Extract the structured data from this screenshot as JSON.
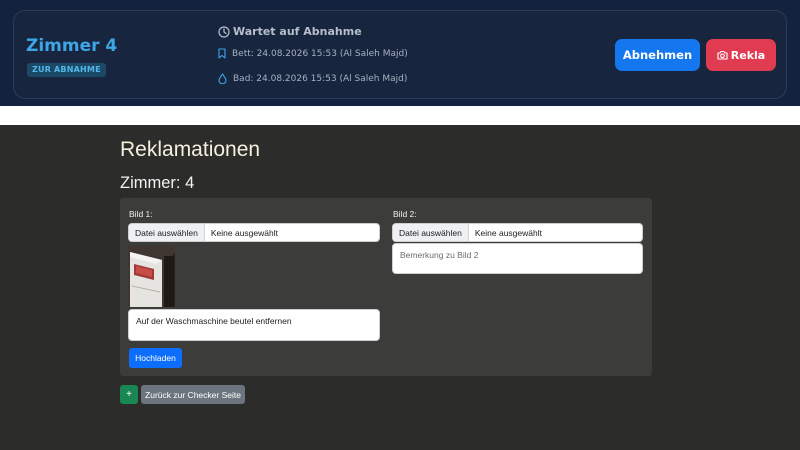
{
  "room_card": {
    "title": "Zimmer 4",
    "badge": "ZUR ABNAHME",
    "status": "Wartet auf Abnahme",
    "bed": "Bett: 24.08.2026 15:53 (Al Saleh Majd)",
    "bath": "Bad: 24.08.2026 15:53 (Al Saleh Majd)",
    "accept_label": "Abnehmen",
    "rekla_label": "Rekla",
    "icons": {
      "status": "clock-icon",
      "bed": "bookmark-icon",
      "bath": "droplet-icon",
      "rekla": "camera-icon"
    },
    "colors": {
      "accent": "#3ea6e6",
      "accept": "#1577f0",
      "rekla": "#e03b50"
    }
  },
  "reklamationen": {
    "heading": "Reklamationen",
    "room": "Zimmer: 4",
    "image1": {
      "label": "Bild 1:",
      "file_button": "Datei auswählen",
      "file_name": "Keine ausgewählt",
      "comment_value": "Auf der Waschmaschine beutel entfernen"
    },
    "image2": {
      "label": "Bild 2:",
      "file_button": "Datei auswählen",
      "file_name": "Keine ausgewählt",
      "comment_placeholder": "Bemerkung zu Bild 2"
    },
    "upload_label": "Hochladen",
    "add_label": "+",
    "back_label": "Zurück zur Checker Seite"
  }
}
